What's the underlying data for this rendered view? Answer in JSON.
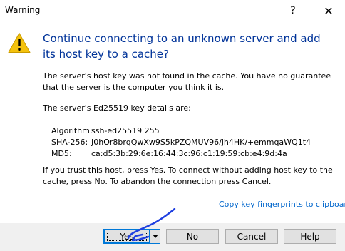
{
  "window": {
    "title": "Warning",
    "help_glyph": "?",
    "close_glyph": "✕"
  },
  "icon": "warning-icon",
  "main_instruction": "Continue connecting to an unknown server and add its host key to a cache?",
  "paragraph1": "The server's host key was not found in the cache. You have no guarantee that the server is the computer you think it is.",
  "paragraph2": "The server's Ed25519 key details are:",
  "details": [
    {
      "label": "Algorithm:",
      "value": "ssh-ed25519 255"
    },
    {
      "label": "SHA-256:",
      "value": "J0hOr8brqQwXw9S5kPZQMUV96/jh4HK/+emmqaWQ1t4"
    },
    {
      "label": "MD5:",
      "value": "ca:d5:3b:29:6e:16:44:3c:96:c1:19:59:cb:e4:9d:4a"
    }
  ],
  "paragraph3": "If you trust this host, press Yes. To connect without adding host key to the cache, press No. To abandon the connection press Cancel.",
  "copy_link": "Copy key fingerprints to clipboard",
  "buttons": {
    "yes": "Yes",
    "no": "No",
    "cancel": "Cancel",
    "help": "Help"
  },
  "colors": {
    "main_instruction": "#003399",
    "link": "#0066cc",
    "footer_bg": "#f0f0f0",
    "focus_border": "#0078d7",
    "annotation_stroke": "#1f3fe0"
  }
}
